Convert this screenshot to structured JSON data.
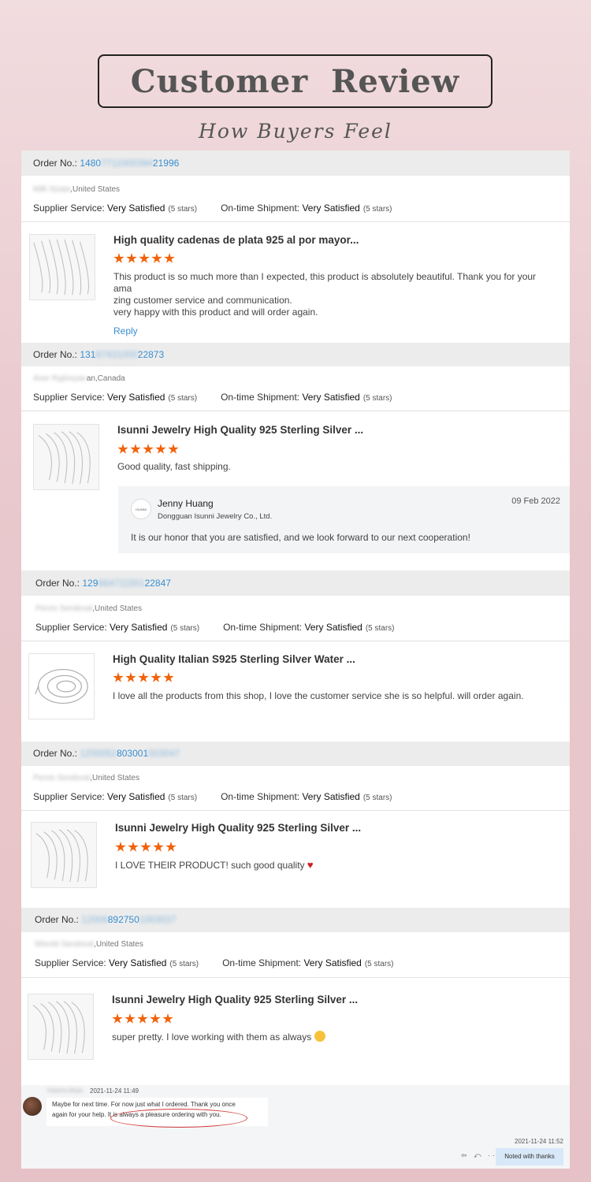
{
  "header": {
    "title": "Customer  Review",
    "subtitle": "How Buyers Feel"
  },
  "labels": {
    "order_no": "Order No.: ",
    "supplier_service": "Supplier Service: ",
    "ontime_shipment": "On-time Shipment: ",
    "rating_value": "Very Satisfied",
    "stars_text": "(5 stars)",
    "reply": "Reply"
  },
  "reviews": [
    {
      "order_pre": "1480",
      "order_mid": "7711000394",
      "order_post": "21996",
      "location_name": "Milli Sizaia",
      "location_country": ",United States",
      "product": "High quality cadenas de plata 925 al por mayor...",
      "rating": 5,
      "text_line1": "This product is so much more than I expected, this product is absolutely beautiful. Thank you for your ama",
      "text_line2": "zing customer service and communication.",
      "text_line3": "very happy with this product and will order again."
    },
    {
      "order_pre": "131",
      "order_mid": "97431000",
      "order_post": "22873",
      "location_name": "Aner Ryjinoyan",
      "location_country": "an,Canada",
      "product": "Isunni Jewelry High Quality 925 Sterling Silver ...",
      "rating": 5,
      "text_line1": "Good quality, fast shipping."
    },
    {
      "order_pre": "129",
      "order_mid": "664711551",
      "order_post": "22847",
      "location_name": "Pervis Sendoval",
      "location_country": ",United States",
      "product": "High Quality Italian S925 Sterling Silver Water ...",
      "rating": 5,
      "text_line1": "I love all the products from this shop, I love the customer service she is so helpful. will order again."
    },
    {
      "order_pre": "1200052",
      "order_mid": "803001",
      "order_post": "003047",
      "location_name": "Pervis Sendoval",
      "location_country": ",United States",
      "product": "Isunni Jewelry High Quality 925 Sterling Silver ...",
      "rating": 5,
      "text_line1": "I LOVE THEIR PRODUCT! such good quality"
    },
    {
      "order_pre": "12006",
      "order_mid": "892750",
      "order_post": "1003037",
      "location_name": "Winold Sandoval",
      "location_country": ",United States",
      "product": "Isunni Jewelry High Quality 925 Sterling Silver ...",
      "rating": 5,
      "text_line1": "super pretty. I love working with them as always"
    }
  ],
  "seller_reply": {
    "logo_text": "ISUNNI",
    "name": "Jenny Huang",
    "company": "Dongguan Isunni Jewelry Co., Ltd.",
    "date": "09 Feb 2022",
    "message": "It is our honor that you are satisfied, and we look forward to our next cooperation!"
  },
  "chat": {
    "buyer_name": "Katarina Bepic",
    "buyer_time": "2021-11-24 11:49",
    "buyer_msg_line1": "Maybe for next time. For now just what I ordered. Thank you once",
    "buyer_msg_line2": "again for your help. It is always a pleasure ordering with you.",
    "reply_time": "2021-11-24 11:52",
    "reply_msg": "Noted with thanks",
    "tools": "⇦ ⤺ ···"
  },
  "colors": {
    "accent_orange": "#f0620a",
    "link_blue": "#3a8fd1",
    "heart_red": "#d01c1c"
  },
  "icons": {
    "rating": "star-icon",
    "heart": "heart-icon",
    "emoji": "smiling-face-icon"
  }
}
